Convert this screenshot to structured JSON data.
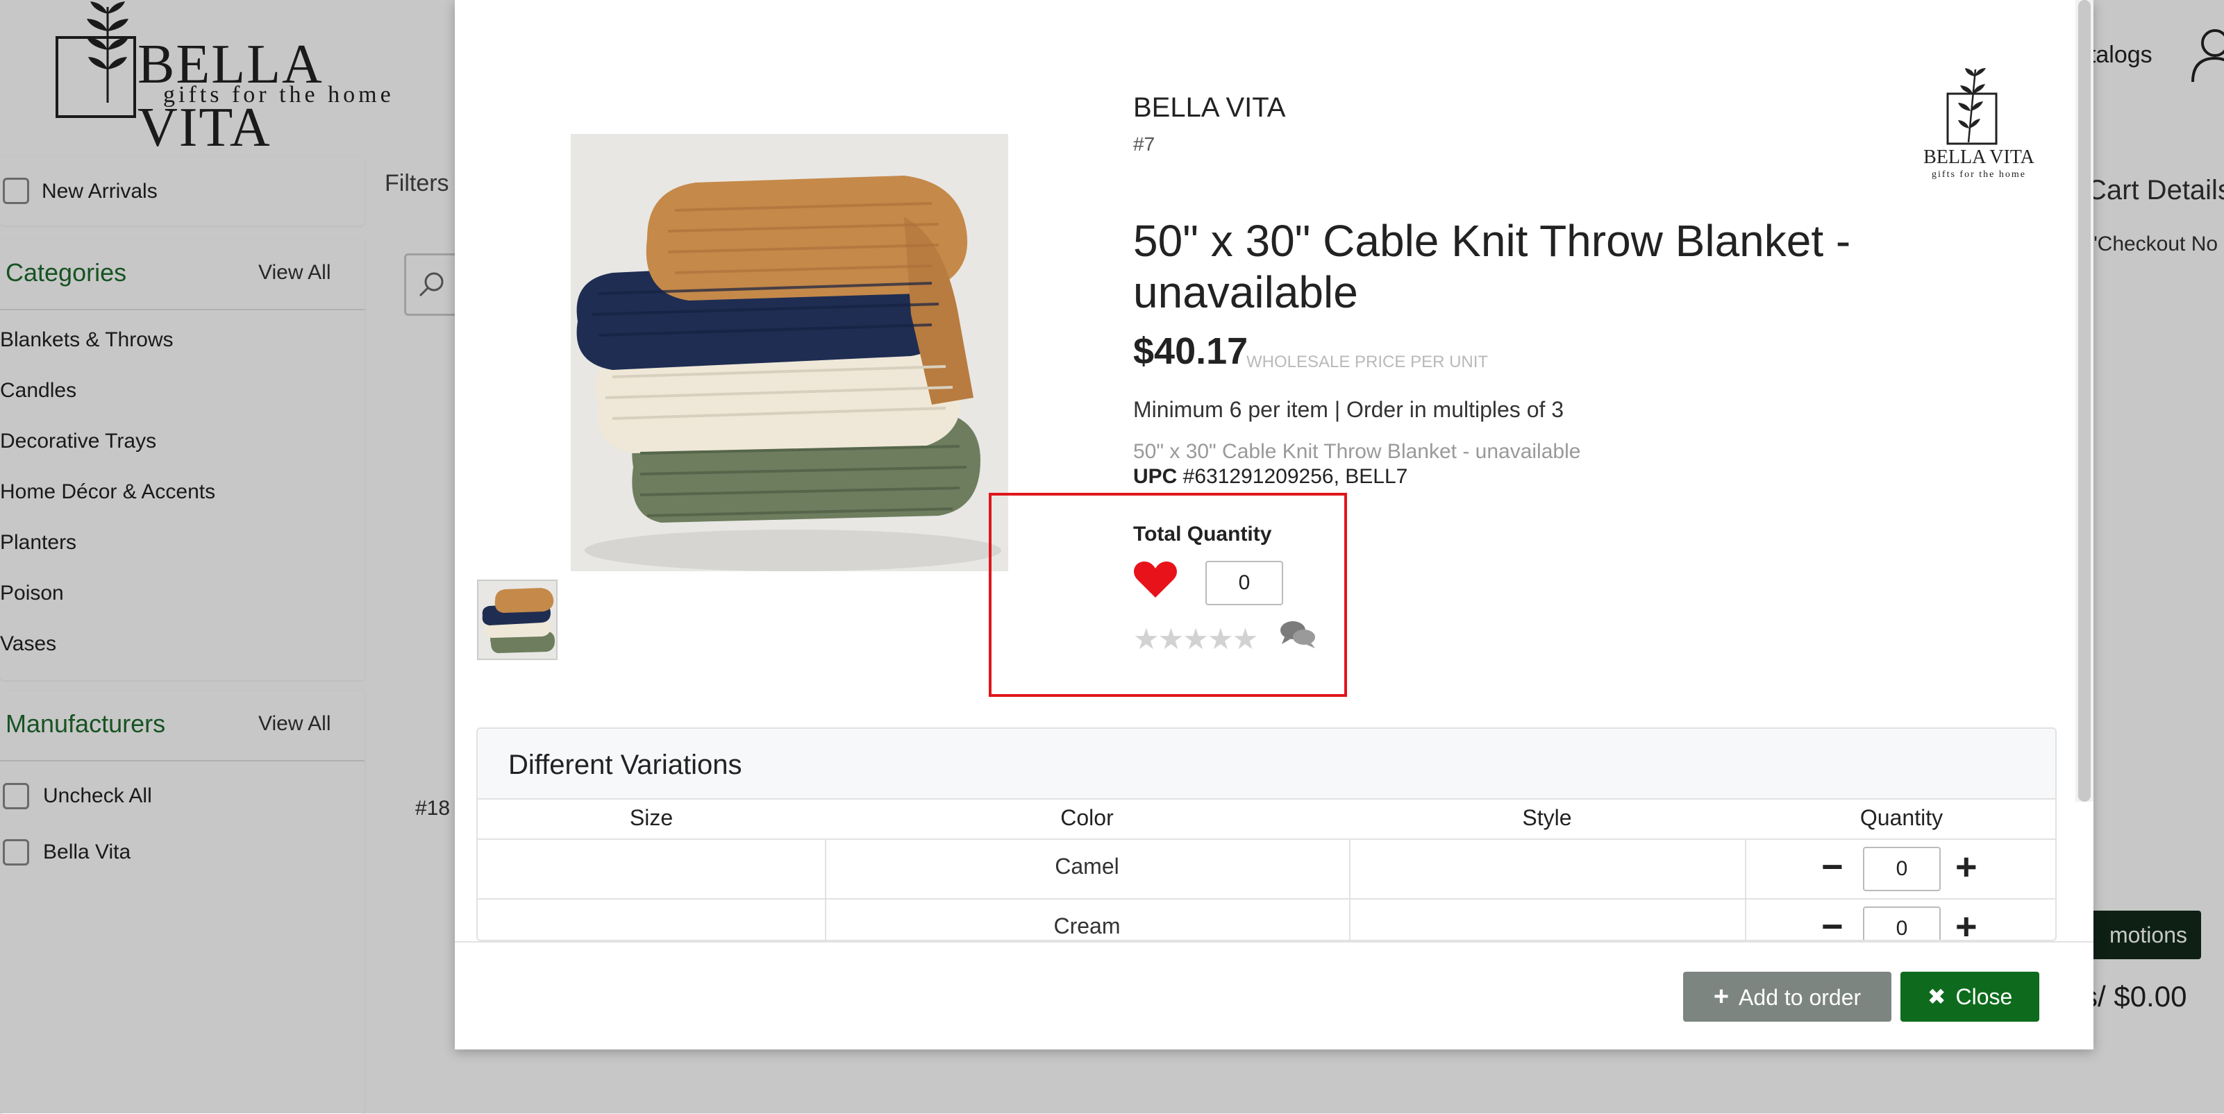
{
  "header": {
    "logo_title": "BELLA VITA",
    "logo_sub": "gifts for the home",
    "nav_catalogs": "atalogs"
  },
  "sidebar": {
    "new_arrivals": "New Arrivals",
    "categories_title": "Categories",
    "categories_view_all": "View All",
    "categories": [
      "Blankets & Throws",
      "Candles",
      "Decorative Trays",
      "Home Décor & Accents",
      "Planters",
      "Poison",
      "Vases"
    ],
    "manufacturers_title": "Manufacturers",
    "manufacturers_view_all": "View All",
    "manufacturers": [
      "Uncheck All",
      "Bella Vita"
    ]
  },
  "main": {
    "filters_label": "Filters",
    "product_number": "#18"
  },
  "cart": {
    "title": "Cart Details",
    "checkout_note": "\"Checkout No",
    "promotions_button": "motions",
    "total": "s/ $0.00"
  },
  "modal": {
    "brand": "BELLA VITA",
    "item_number": "#7",
    "logo_title": "BELLA VITA",
    "logo_sub": "gifts for the home",
    "title": "50\" x 30\" Cable Knit Throw Blanket - unavailable",
    "price": "$40.17",
    "price_label": "WHOLESALE PRICE PER UNIT",
    "min_order": "Minimum 6 per item | Order in multiples of 3",
    "description": "50\" x 30\" Cable Knit Throw Blanket - unavailable",
    "upc_label": "UPC",
    "upc_value": " #631291209256, BELL7",
    "total_quantity_label": "Total Quantity",
    "total_quantity_value": "0",
    "rating_stars": "★★★★★",
    "rating": 0,
    "variations_title": "Different Variations",
    "columns": [
      "Size",
      "Color",
      "Style",
      "Quantity"
    ],
    "rows": [
      {
        "size": "",
        "color": "Camel",
        "style": "",
        "quantity": "0"
      },
      {
        "size": "",
        "color": "Cream",
        "style": "",
        "quantity": "0"
      }
    ],
    "add_to_order": "Add to order",
    "close": "Close"
  },
  "colors": {
    "accent_green": "#0e6b1d",
    "category_heading": "#1e6b2e",
    "highlight_red": "#e0161b",
    "heart_red": "#e8121a"
  },
  "icons": {
    "heart": "heart-icon",
    "chat": "chat-icon",
    "plus": "plus-icon",
    "minus": "minus-icon",
    "close": "close-x-icon",
    "search": "search-icon",
    "user": "user-icon"
  }
}
